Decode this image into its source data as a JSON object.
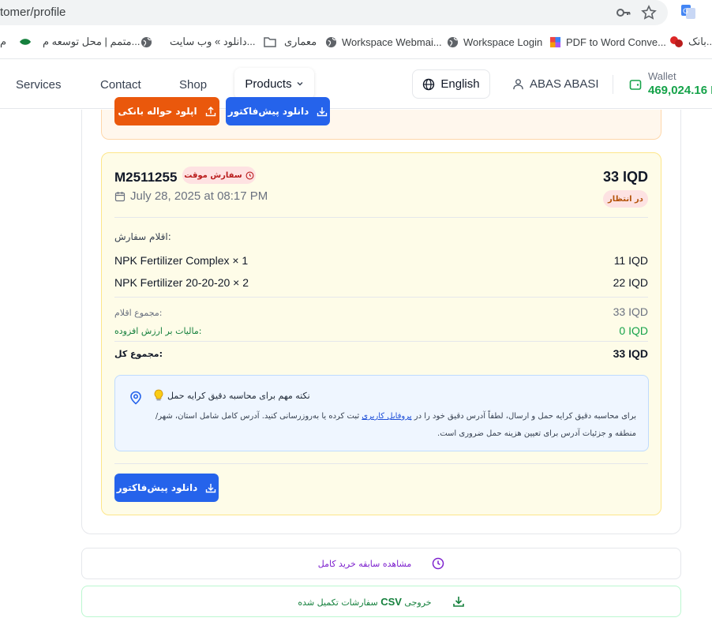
{
  "browser": {
    "url": "tomer/profile",
    "bookmarks": [
      {
        "label": "م"
      },
      {
        "label": "متمم | محل توسعه م..."
      },
      {
        "label": "دانلود » وب سایت..."
      },
      {
        "label": "معماری"
      },
      {
        "label": "Workspace Webmai..."
      },
      {
        "label": "Workspace Login"
      },
      {
        "label": "PDF to Word Conve..."
      },
      {
        "label": "بانک..."
      }
    ]
  },
  "nav": {
    "links": [
      "Services",
      "Contact",
      "Shop"
    ],
    "products_label": "Products",
    "language_label": "English",
    "user_name": "ABAS ABASI",
    "wallet_label": "Wallet",
    "wallet_value": "469,024.16 I"
  },
  "prev_order": {
    "upload_label": "اپلود حواله بانکی",
    "download_label": "دانلود پیش‌فاکتور"
  },
  "order": {
    "id": "M2511255",
    "temp_badge": "سفارش موقت",
    "date": "July 28, 2025 at 08:17 PM",
    "total_top": "33 IQD",
    "status_badge": "در انتظار",
    "items_title": "اقلام سفارش:",
    "items": [
      {
        "name": "NPK Fertilizer Complex × 1",
        "price": "11 IQD"
      },
      {
        "name": "NPK Fertilizer 20-20-20 × 2",
        "price": "22 IQD"
      }
    ],
    "subtotal_label": "مجموع اقلام:",
    "subtotal_value": "33 IQD",
    "vat_label": "مالیات بر ارزش افزوده:",
    "vat_value": "0 IQD",
    "total_label": "مجموع کل:",
    "total_value": "33 IQD",
    "note_title": "نکته مهم برای محاسبه دقیق کرایه حمل",
    "note_text_before": "برای محاسبه دقیق کرایه حمل و ارسال، لطفاً آدرس دقیق خود را در ",
    "note_link": "پروفایل کاربری",
    "note_text_after": " ثبت کرده یا به‌روزرسانی کنید. آدرس کامل شامل استان، شهر/منطقه و جزئیات آدرس برای تعیین هزینه حمل ضروری است.",
    "download_label": "دانلود پیش‌فاکتور"
  },
  "actions": {
    "history_label": "مشاهده سابقه خرید کامل",
    "csv_prefix": "CSV",
    "csv_label_before": "سفارشات تکمیل شده",
    "csv_label_after": "خروجی"
  },
  "colors": {
    "primary_blue": "#2563eb",
    "orange": "#ea580c",
    "wallet_green": "#16a34a"
  }
}
